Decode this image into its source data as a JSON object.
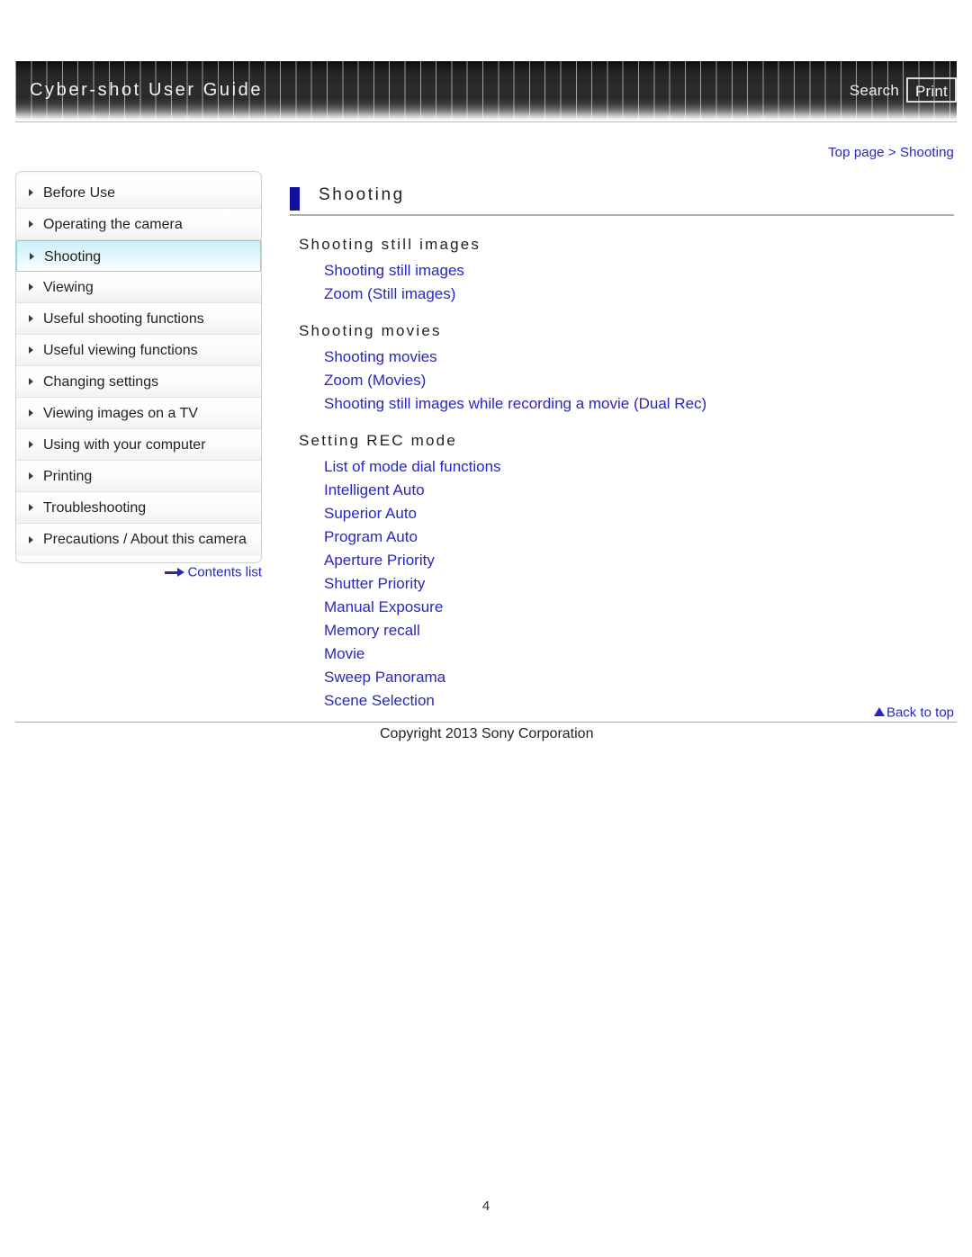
{
  "header": {
    "title": "Cyber-shot User Guide",
    "search_label": "Search",
    "print_label": "Print"
  },
  "breadcrumb": {
    "text": "Top page > Shooting"
  },
  "sidebar": {
    "items": [
      {
        "label": "Before Use",
        "active": false
      },
      {
        "label": "Operating the camera",
        "active": false
      },
      {
        "label": "Shooting",
        "active": true
      },
      {
        "label": "Viewing",
        "active": false
      },
      {
        "label": "Useful shooting functions",
        "active": false
      },
      {
        "label": "Useful viewing functions",
        "active": false
      },
      {
        "label": "Changing settings",
        "active": false
      },
      {
        "label": "Viewing images on a TV",
        "active": false
      },
      {
        "label": "Using with your computer",
        "active": false
      },
      {
        "label": "Printing",
        "active": false
      },
      {
        "label": "Troubleshooting",
        "active": false
      },
      {
        "label": "Precautions / About this camera",
        "active": false
      }
    ],
    "contents_list_label": "Contents list"
  },
  "main": {
    "page_title": "Shooting",
    "sections": [
      {
        "heading": "Shooting still images",
        "links": [
          "Shooting still images",
          "Zoom (Still images)"
        ]
      },
      {
        "heading": "Shooting movies",
        "links": [
          "Shooting movies",
          "Zoom (Movies)",
          "Shooting still images while recording a movie (Dual Rec)"
        ]
      },
      {
        "heading": "Setting REC mode",
        "links": [
          "List of mode dial functions",
          "Intelligent Auto",
          "Superior Auto",
          "Program Auto",
          "Aperture Priority",
          "Shutter Priority",
          "Manual Exposure",
          "Memory recall",
          "Movie",
          "Sweep Panorama",
          "Scene Selection"
        ]
      }
    ]
  },
  "footer": {
    "back_to_top_label": "Back to top",
    "copyright": "Copyright 2013 Sony Corporation",
    "page_number": "4"
  },
  "colors": {
    "link": "#2a26c4",
    "title_mark": "#12109b",
    "active_nav_border": "#7fd4e8"
  }
}
